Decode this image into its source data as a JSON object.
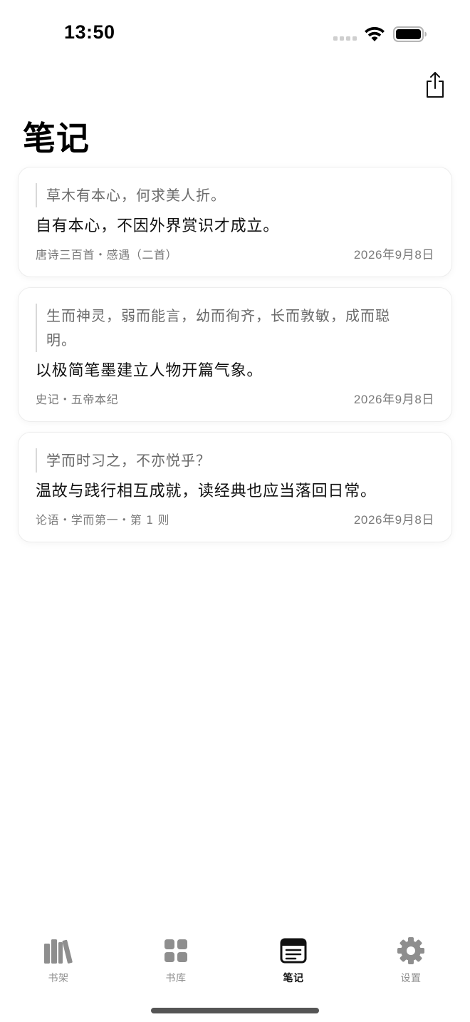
{
  "status_bar": {
    "time": "13:50"
  },
  "header": {
    "title": "笔记",
    "share_icon": "share-icon"
  },
  "notes": [
    {
      "quote": "草木有本心，何求美人折。",
      "text": "自有本心，不因外界赏识才成立。",
      "source": "唐诗三百首・感遇（二首）",
      "date": "2026年9月8日"
    },
    {
      "quote": "生而神灵，弱而能言，幼而徇齐，长而敦敏，成而聪明。",
      "text": "以极简笔墨建立人物开篇气象。",
      "source": "史记・五帝本纪",
      "date": "2026年9月8日"
    },
    {
      "quote": "学而时习之，不亦悦乎？",
      "text": "温故与践行相互成就，读经典也应当落回日常。",
      "source": "论语・学而第一・第 1 则",
      "date": "2026年9月8日"
    }
  ],
  "tab_bar": {
    "items": [
      {
        "label": "书架",
        "icon": "bookshelf-icon"
      },
      {
        "label": "书库",
        "icon": "grid-icon"
      },
      {
        "label": "笔记",
        "icon": "notes-icon",
        "active": true
      },
      {
        "label": "设置",
        "icon": "gear-icon"
      }
    ]
  },
  "colors": {
    "accent": "#111111",
    "inactive_tab": "#8e8e8e",
    "quote_text": "#6a6a6a"
  }
}
